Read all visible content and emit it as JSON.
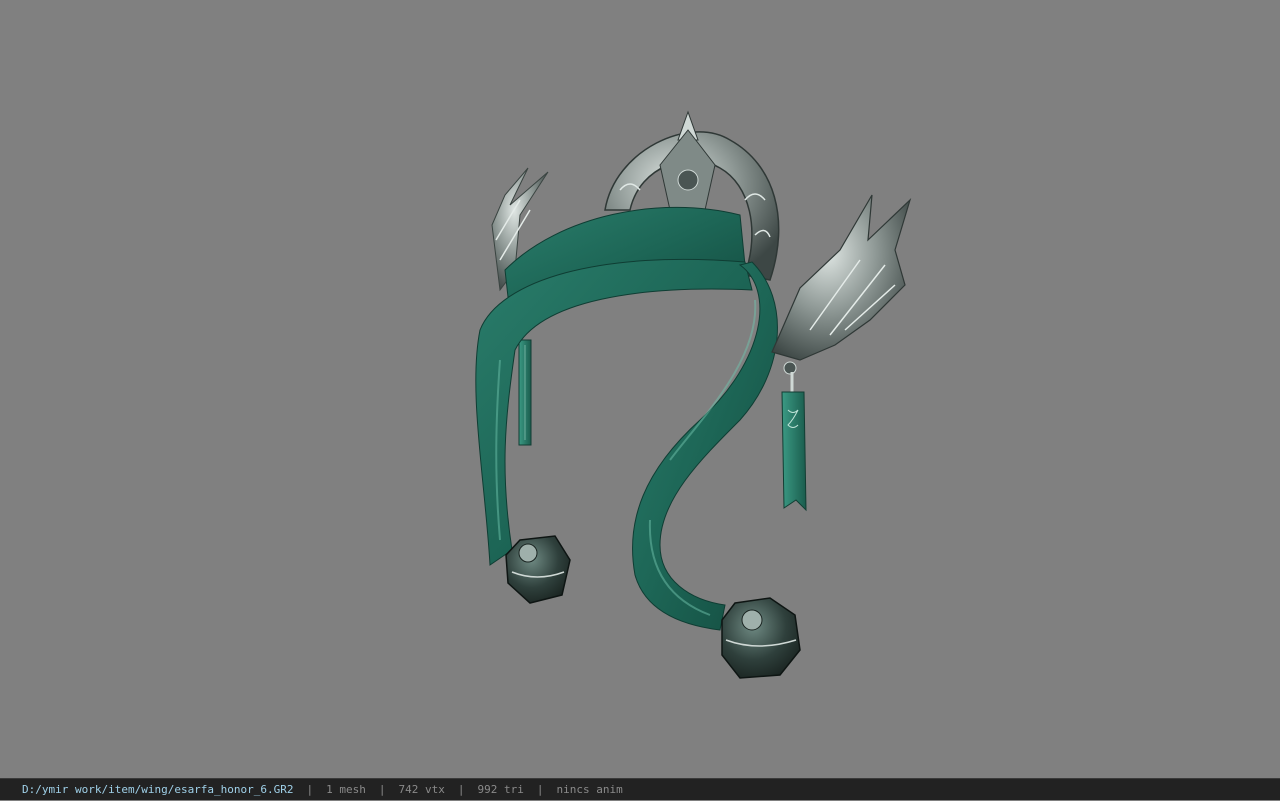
{
  "viewport": {
    "background": "#808080",
    "model_name": "esarfa_honor_6"
  },
  "status_bar": {
    "file_path": "D:/ymir work/item/wing/esarfa_honor_6.GR2",
    "separator": "|",
    "mesh_count": "1 mesh",
    "vertex_count": "742 vtx",
    "triangle_count": "992 tri",
    "anim_status": "nincs anim"
  },
  "colors": {
    "scarf_green": "#1f6b5a",
    "silver": "#9aa3a0",
    "status_bg": "#222222",
    "path_text": "#9fd0e8",
    "stat_text": "#8a8a8a"
  }
}
